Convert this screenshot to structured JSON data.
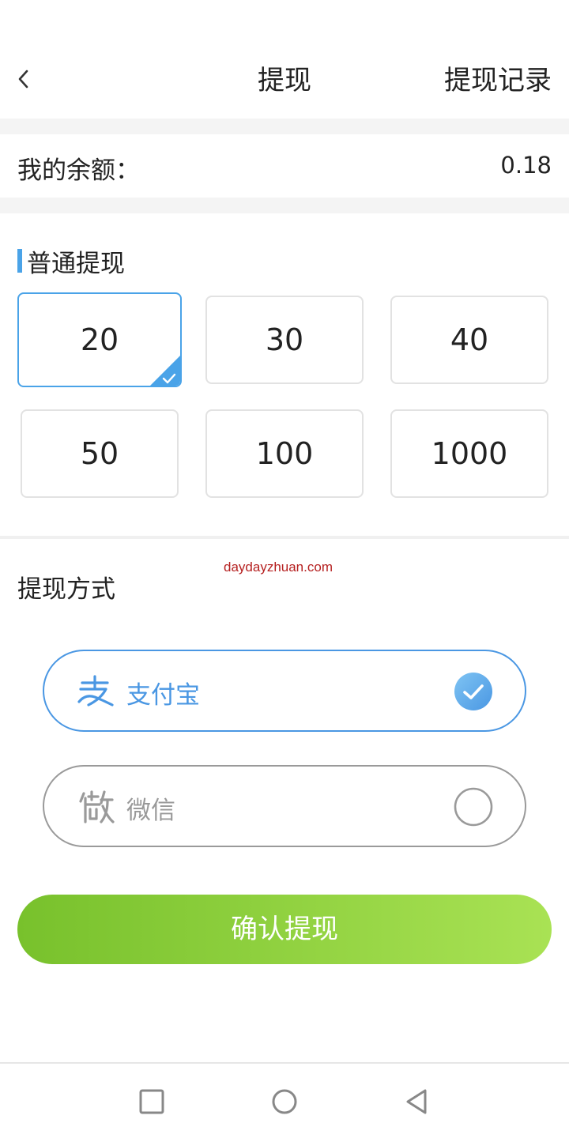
{
  "header": {
    "title": "提现",
    "record_link": "提现记录"
  },
  "balance": {
    "label": "我的余额：",
    "value": "0.18"
  },
  "normal_withdraw": {
    "title": "普通提现",
    "amounts": [
      "20",
      "30",
      "40",
      "50",
      "100",
      "1000"
    ],
    "selected": "20"
  },
  "method": {
    "title": "提现方式",
    "watermark": "daydayzhuan.com",
    "options": [
      {
        "label": "支付宝",
        "icon": "alipay-icon",
        "selected": true
      },
      {
        "label": "微信",
        "icon": "wechat-icon",
        "selected": false
      }
    ]
  },
  "confirm_label": "确认提现",
  "colors": {
    "accent_blue": "#4aa3e8",
    "button_gradient_start": "#78c12c",
    "button_gradient_end": "#a9e254",
    "watermark": "#b51f1f"
  },
  "navbar": {
    "icons": [
      "recent-apps-icon",
      "home-icon",
      "back-nav-icon"
    ]
  }
}
